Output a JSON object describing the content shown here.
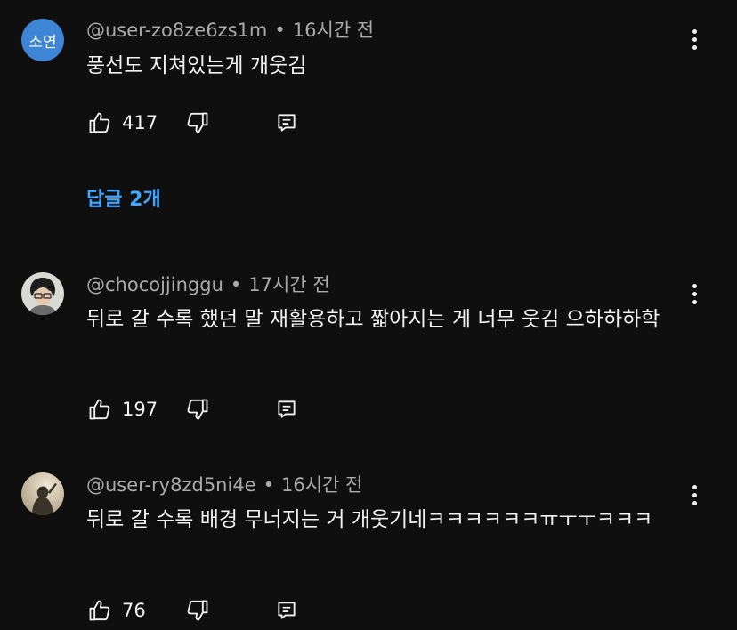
{
  "comments": [
    {
      "avatar_text": "소연",
      "author": "@user-zo8ze6zs1m",
      "time": "16시간 전",
      "text": "풍선도 지쳐있는게 개웃김",
      "likes": "417",
      "replies_label": "답글 2개"
    },
    {
      "author": "@chocojjinggu",
      "time": "17시간 전",
      "text": "뒤로 갈 수록 했던 말 재활용하고 짧아지는 게 너무 웃김 으하하하학",
      "likes": "197"
    },
    {
      "author": "@user-ry8zd5ni4e",
      "time": "16시간 전",
      "text": "뒤로 갈 수록 배경 무너지는 거 개웃기네ㅋㅋㅋㅋㅋㅋㅠㅜㅜㅋㅋㅋ",
      "likes": "76"
    }
  ],
  "separator": "•",
  "icons": {
    "like": "thumbs-up-icon",
    "dislike": "thumbs-down-icon",
    "reply": "reply-icon",
    "more": "more-vertical-icon"
  },
  "colors": {
    "background": "#0f0f0f",
    "text": "#f1f1f1",
    "secondary_text": "#aaaaaa",
    "link": "#3ea6ff",
    "avatar_blue": "#3e85d6"
  }
}
